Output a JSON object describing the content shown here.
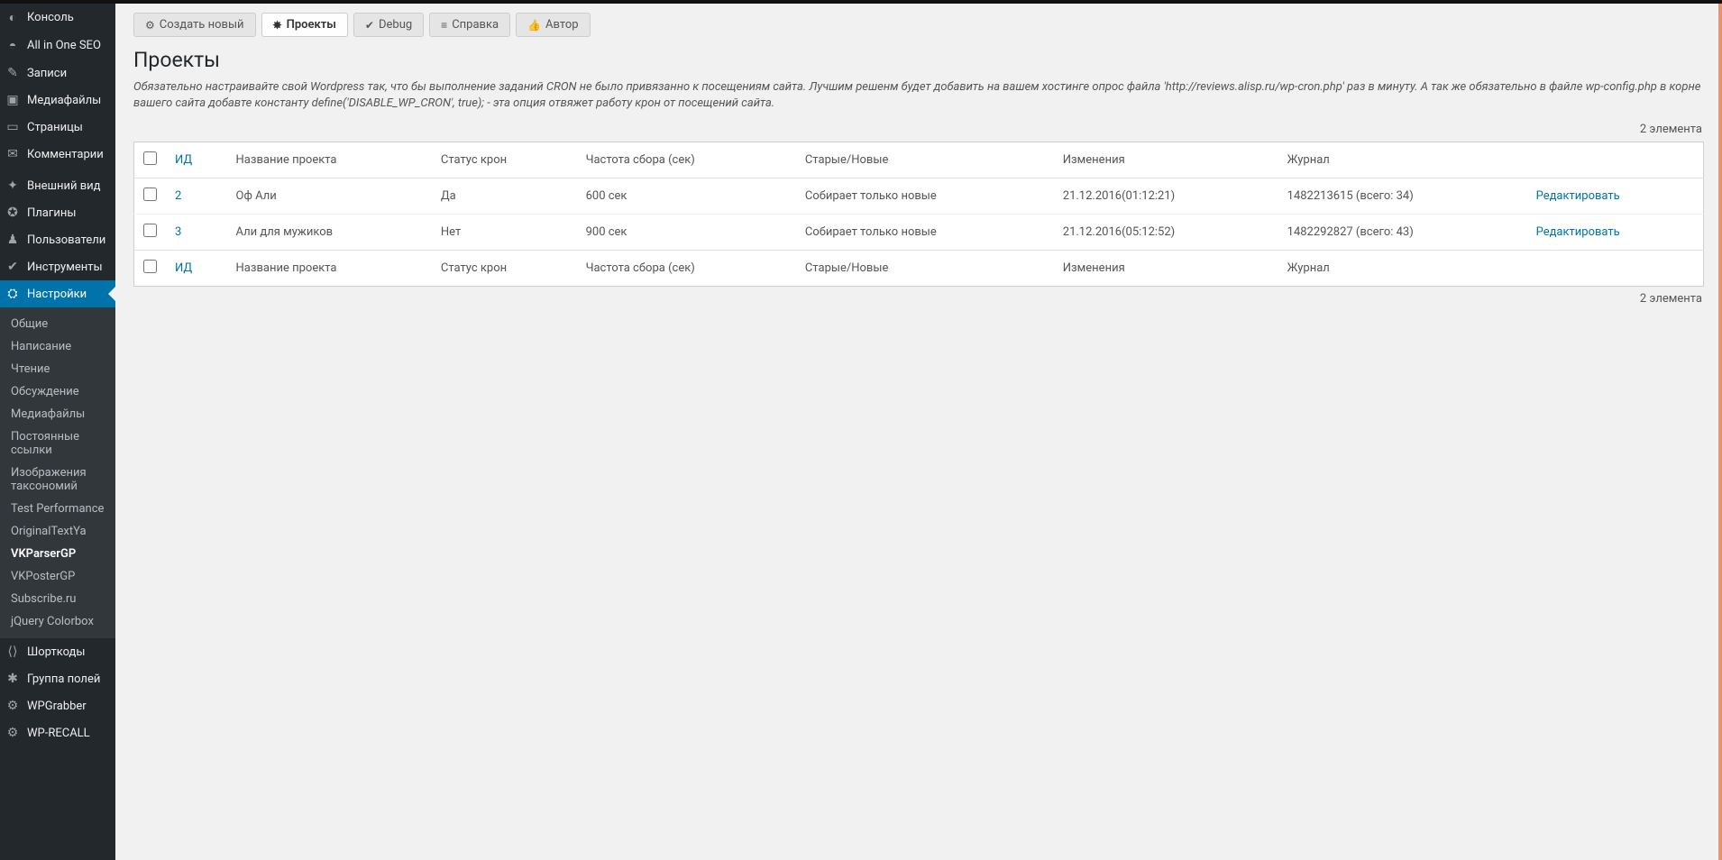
{
  "sidebar": {
    "items": [
      {
        "icon": "◐",
        "label": "Консоль"
      },
      {
        "icon": "◓",
        "label": "All in One SEO"
      },
      {
        "icon": "✎",
        "label": "Записи"
      },
      {
        "icon": "▣",
        "label": "Медиафайлы"
      },
      {
        "icon": "▭",
        "label": "Страницы"
      },
      {
        "icon": "✉",
        "label": "Комментарии"
      },
      {
        "icon": "✦",
        "label": "Внешний вид"
      },
      {
        "icon": "✪",
        "label": "Плагины"
      },
      {
        "icon": "♟",
        "label": "Пользователи"
      },
      {
        "icon": "✔",
        "label": "Инструменты"
      },
      {
        "icon": "⛭",
        "label": "Настройки"
      }
    ],
    "submenu": [
      "Общие",
      "Написание",
      "Чтение",
      "Обсуждение",
      "Медиафайлы",
      "Постоянные ссылки",
      "Изображения таксономий",
      "Test Performance",
      "OriginalTextYa",
      "VKParserGP",
      "VKPosterGP",
      "Subscribe.ru",
      "jQuery Colorbox"
    ],
    "submenu_current": "VKParserGP",
    "items2": [
      {
        "icon": "⟨⟩",
        "label": "Шорткоды"
      },
      {
        "icon": "✱",
        "label": "Группа полей"
      },
      {
        "icon": "⚙",
        "label": "WPGrabber"
      },
      {
        "icon": "⚙",
        "label": "WP-RECALL"
      }
    ]
  },
  "tabs": [
    {
      "icon": "⚙",
      "label": "Создать новый",
      "active": false
    },
    {
      "icon": "✸",
      "label": "Проекты",
      "active": true
    },
    {
      "icon": "✔",
      "label": "Debug",
      "active": false
    },
    {
      "icon": "≡",
      "label": "Справка",
      "active": false
    },
    {
      "icon": "👍",
      "label": "Автор",
      "active": false
    }
  ],
  "page": {
    "title": "Проекты",
    "subtitle": "Обязательно настраивайте свой Wordpress так, что бы выполнение заданий CRON не было привязанно к посещениям сайта. Лучшим решенм будет добавить на вашем хостинге опрос файла 'http://reviews.alisp.ru/wp-cron.php' раз в минуту.  А так же обязательно в файле wp-config.php в корне вашего сайта добавте константу define('DISABLE_WP_CRON', true); - эта опция отвяжет работу крон от посещений сайта.",
    "count_label": "2 элемента"
  },
  "table": {
    "columns": {
      "id": "ИД",
      "name": "Название проекта",
      "cron": "Статус крон",
      "freq": "Частота сбора (сек)",
      "mode": "Старые/Новые",
      "changes": "Изменения",
      "log": "Журнал"
    },
    "action_edit": "Редактировать",
    "rows": [
      {
        "id": "2",
        "name": "Оф Али",
        "cron": "Да",
        "freq": "600 сек",
        "mode": "Собирает только новые",
        "changes": "21.12.2016(01:12:21)",
        "log": "1482213615 (всего: 34)"
      },
      {
        "id": "3",
        "name": "Али для мужиков",
        "cron": "Нет",
        "freq": "900 сек",
        "mode": "Собирает только новые",
        "changes": "21.12.2016(05:12:52)",
        "log": "1482292827 (всего: 43)"
      }
    ]
  }
}
